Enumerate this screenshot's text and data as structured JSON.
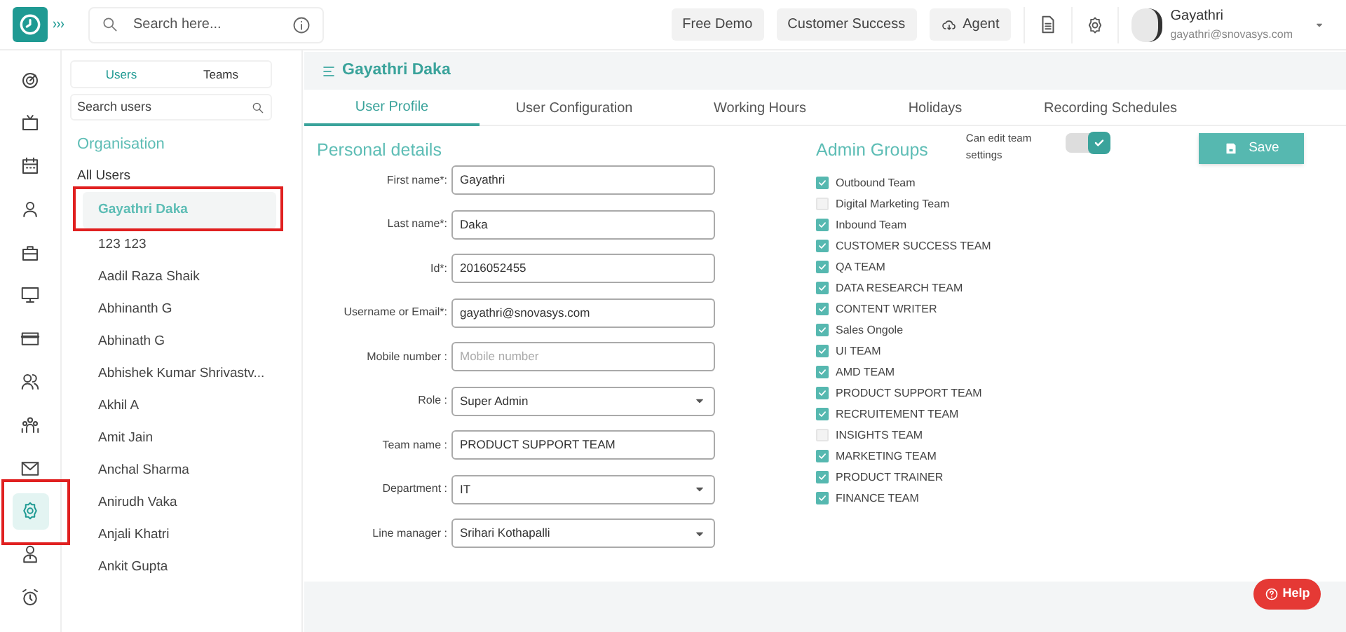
{
  "topbar": {
    "search_placeholder": "Search here...",
    "buttons": [
      "Free Demo",
      "Customer Success",
      "Agent"
    ],
    "user_name": "Gayathri",
    "user_email": "gayathri@snovasys.com"
  },
  "nav_items": [
    {
      "selected": false
    },
    {
      "selected": false
    },
    {
      "selected": false
    },
    {
      "selected": false
    },
    {
      "selected": false
    },
    {
      "selected": false
    },
    {
      "selected": false
    },
    {
      "selected": false
    },
    {
      "selected": false
    },
    {
      "selected": false
    },
    {
      "selected": true
    },
    {
      "selected": false
    },
    {
      "selected": false
    }
  ],
  "users_panel": {
    "tabs": [
      {
        "label": "Users",
        "selected": true
      },
      {
        "label": "Teams",
        "selected": false
      }
    ],
    "search_placeholder": "Search users",
    "heading": "Organisation",
    "all_label": "All Users",
    "users": [
      {
        "name": "Gayathri Daka",
        "selected": true
      },
      {
        "name": "123 123",
        "selected": false
      },
      {
        "name": "Aadil Raza Shaik",
        "selected": false
      },
      {
        "name": "Abhinanth G",
        "selected": false
      },
      {
        "name": "Abhinath G",
        "selected": false
      },
      {
        "name": "Abhishek Kumar Shrivastv...",
        "selected": false
      },
      {
        "name": "Akhil A",
        "selected": false
      },
      {
        "name": "Amit Jain",
        "selected": false
      },
      {
        "name": "Anchal Sharma",
        "selected": false
      },
      {
        "name": "Anirudh Vaka",
        "selected": false
      },
      {
        "name": "Anjali Khatri",
        "selected": false
      },
      {
        "name": "Ankit Gupta",
        "selected": false
      }
    ]
  },
  "profile": {
    "title": "Gayathri Daka",
    "tabs": [
      {
        "label": "User Profile",
        "selected": true
      },
      {
        "label": "User Configuration",
        "selected": false
      },
      {
        "label": "Working Hours",
        "selected": false
      },
      {
        "label": "Holidays",
        "selected": false
      },
      {
        "label": "Recording Schedules",
        "selected": false
      }
    ],
    "personal_heading": "Personal details",
    "fields": [
      {
        "label": "First name*:",
        "value": "Gayathri",
        "kind": "text"
      },
      {
        "label": "Last name*:",
        "value": "Daka",
        "kind": "text"
      },
      {
        "label": "Id*:",
        "value": "2016052455",
        "kind": "text"
      },
      {
        "label": "Username or Email*:",
        "value": "gayathri@snovasys.com",
        "kind": "text"
      },
      {
        "label": "Mobile number :",
        "placeholder": "Mobile number",
        "kind": "text"
      },
      {
        "label": "Role :",
        "value": "Super Admin",
        "kind": "select"
      },
      {
        "label": "Team name :",
        "value": "PRODUCT SUPPORT TEAM",
        "kind": "text"
      },
      {
        "label": "Department :",
        "value": "IT",
        "kind": "select"
      },
      {
        "label": "Line manager :",
        "value": "Srihari Kothapalli",
        "kind": "select"
      }
    ],
    "admin_heading": "Admin Groups",
    "toggle_label": "Can edit team settings",
    "toggle_on": true,
    "save_label": "Save",
    "groups": [
      {
        "label": "Outbound Team",
        "checked": true
      },
      {
        "label": "Digital Marketing Team",
        "checked": false
      },
      {
        "label": "Inbound Team",
        "checked": true
      },
      {
        "label": "CUSTOMER SUCCESS TEAM",
        "checked": true
      },
      {
        "label": "QA TEAM",
        "checked": true
      },
      {
        "label": "DATA RESEARCH TEAM",
        "checked": true
      },
      {
        "label": "CONTENT WRITER",
        "checked": true
      },
      {
        "label": "Sales Ongole",
        "checked": true
      },
      {
        "label": "UI TEAM",
        "checked": true
      },
      {
        "label": "AMD TEAM",
        "checked": true
      },
      {
        "label": "PRODUCT SUPPORT TEAM",
        "checked": true
      },
      {
        "label": "RECRUITEMENT TEAM",
        "checked": true
      },
      {
        "label": "INSIGHTS TEAM",
        "checked": false
      },
      {
        "label": "MARKETING TEAM",
        "checked": true
      },
      {
        "label": "PRODUCT TRAINER",
        "checked": true
      },
      {
        "label": "FINANCE TEAM",
        "checked": true
      }
    ]
  },
  "help_label": "Help"
}
